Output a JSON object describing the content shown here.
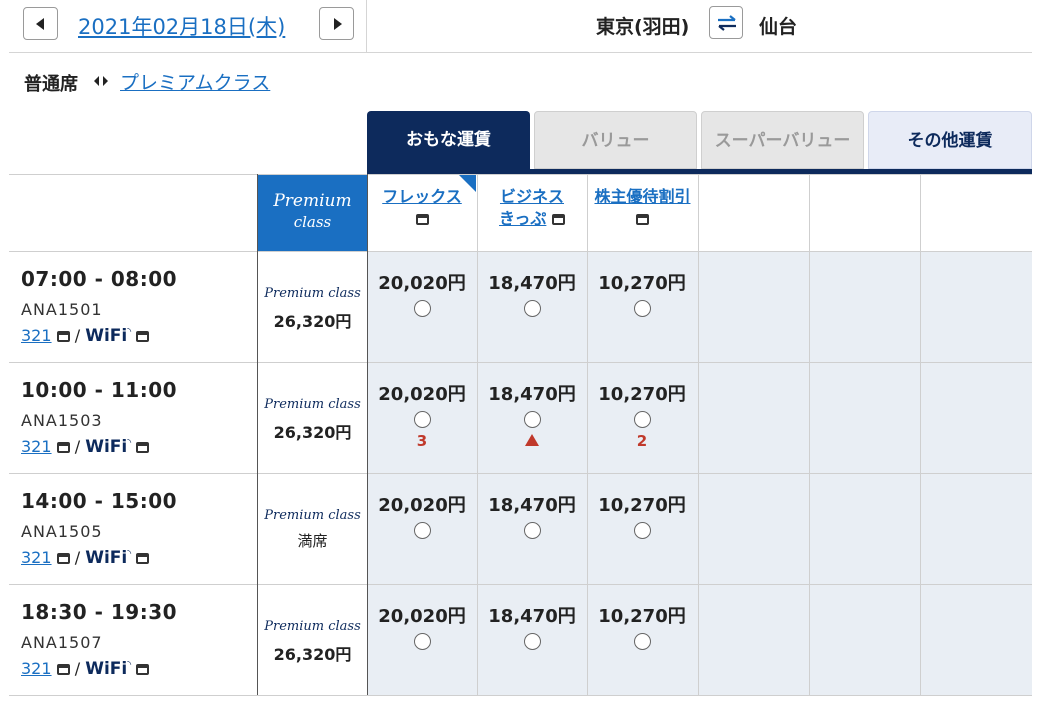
{
  "header": {
    "date": "2021年02月18日(木)",
    "origin": "東京(羽田)",
    "destination": "仙台"
  },
  "cabin": {
    "current": "普通席",
    "alt": "プレミアムクラス"
  },
  "tabs": [
    "おもな運賃",
    "バリュー",
    "スーパーバリュー",
    "その他運賃"
  ],
  "premium_header": {
    "line1": "Premium",
    "line2": "class"
  },
  "premium_label": "Premium class",
  "fare_types": [
    {
      "line1": "フレックス",
      "line2": ""
    },
    {
      "line1": "ビジネス",
      "line2": "きっぷ"
    },
    {
      "line1": "株主優待割引",
      "line2": ""
    }
  ],
  "flights": [
    {
      "time": "07:00 - 08:00",
      "flight_no": "ANA1501",
      "aircraft": "321",
      "wifi": "WiFi",
      "premium_price": "26,320円",
      "fares": [
        {
          "price": "20,020円",
          "seats": ""
        },
        {
          "price": "18,470円",
          "seats": ""
        },
        {
          "price": "10,270円",
          "seats": ""
        }
      ]
    },
    {
      "time": "10:00 - 11:00",
      "flight_no": "ANA1503",
      "aircraft": "321",
      "wifi": "WiFi",
      "premium_price": "26,320円",
      "fares": [
        {
          "price": "20,020円",
          "seats": "3"
        },
        {
          "price": "18,470円",
          "seats": "▲"
        },
        {
          "price": "10,270円",
          "seats": "2"
        }
      ]
    },
    {
      "time": "14:00 - 15:00",
      "flight_no": "ANA1505",
      "aircraft": "321",
      "wifi": "WiFi",
      "premium_price": "満席",
      "fares": [
        {
          "price": "20,020円",
          "seats": ""
        },
        {
          "price": "18,470円",
          "seats": ""
        },
        {
          "price": "10,270円",
          "seats": ""
        }
      ]
    },
    {
      "time": "18:30 - 19:30",
      "flight_no": "ANA1507",
      "aircraft": "321",
      "wifi": "WiFi",
      "premium_price": "26,320円",
      "fares": [
        {
          "price": "20,020円",
          "seats": ""
        },
        {
          "price": "18,470円",
          "seats": ""
        },
        {
          "price": "10,270円",
          "seats": ""
        }
      ]
    }
  ],
  "colors": {
    "navy": "#0d2a5c",
    "blue": "#1a6fc2",
    "alert": "#c0392b",
    "shade": "#e9eef4"
  }
}
